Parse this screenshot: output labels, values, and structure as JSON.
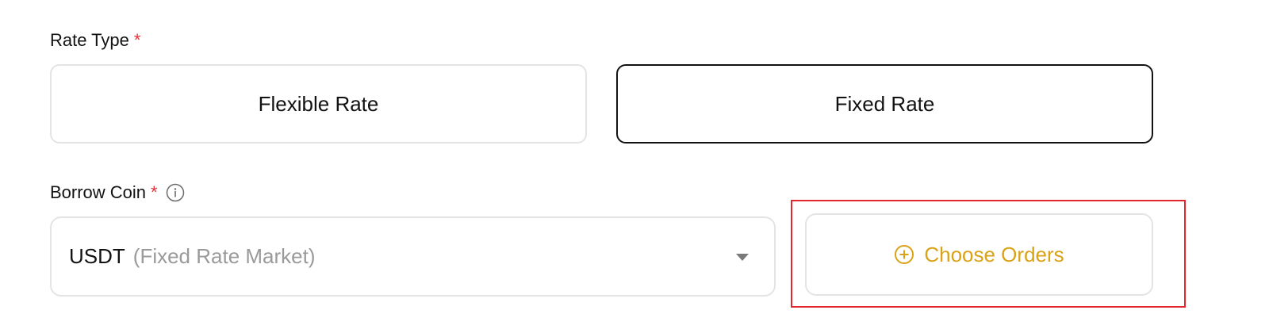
{
  "rate_type": {
    "label": "Rate Type",
    "required_mark": "*",
    "options": [
      {
        "label": "Flexible Rate",
        "selected": false
      },
      {
        "label": "Fixed Rate",
        "selected": true
      }
    ]
  },
  "borrow_coin": {
    "label": "Borrow Coin",
    "required_mark": "*",
    "info_icon": "info-icon",
    "selected_symbol": "USDT",
    "selected_market": "(Fixed Rate Market)",
    "dropdown_icon": "caret-down-icon"
  },
  "choose_orders": {
    "label": "Choose Orders",
    "icon": "plus-circle-icon",
    "color": "#d9a217"
  },
  "colors": {
    "required": "#e0323a",
    "selected_border": "#121212",
    "default_border": "#e4e4e4",
    "highlight": "#e3262c",
    "muted_text": "#9a9a9a"
  }
}
